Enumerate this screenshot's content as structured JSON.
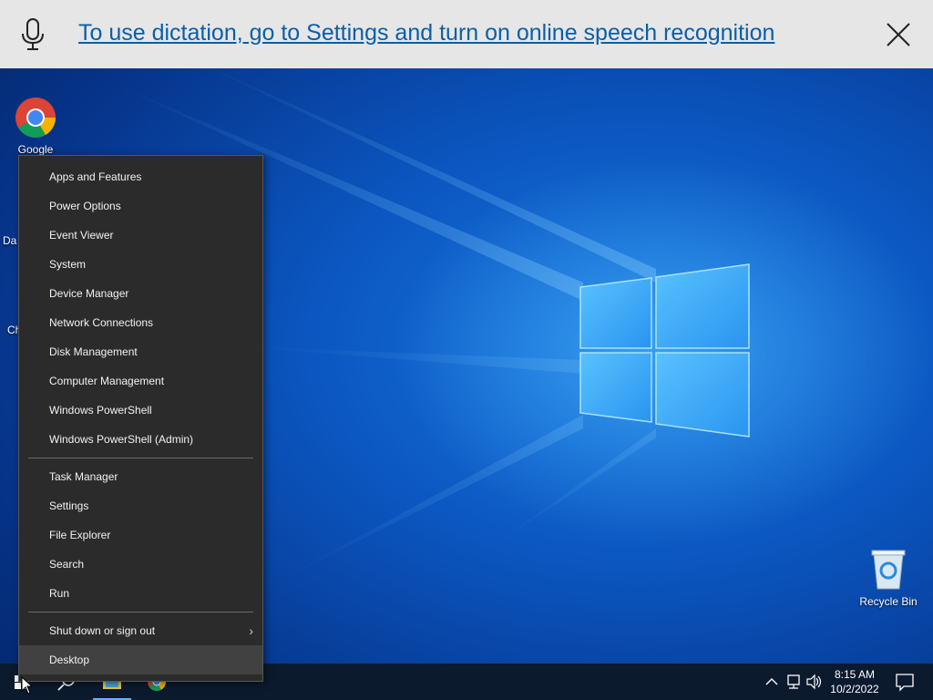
{
  "dictation": {
    "message": "To use dictation, go to Settings and turn on online speech recognition",
    "mic_icon": "microphone-icon",
    "close_icon": "close-icon"
  },
  "desktop_icons": [
    {
      "label": "Google",
      "icon": "chrome-icon"
    },
    {
      "label": "Recycle Bin",
      "icon": "recycle-bin-icon"
    }
  ],
  "partial_labels": [
    "Da",
    "Ch"
  ],
  "menu": {
    "group1": [
      "Apps and Features",
      "Power Options",
      "Event Viewer",
      "System",
      "Device Manager",
      "Network Connections",
      "Disk Management",
      "Computer Management",
      "Windows PowerShell",
      "Windows PowerShell (Admin)"
    ],
    "group2": [
      "Task Manager",
      "Settings",
      "File Explorer",
      "Search",
      "Run"
    ],
    "shutdown": "Shut down or sign out",
    "desktop": "Desktop"
  },
  "taskbar": {
    "time": "8:15 AM",
    "date": "10/2/2022",
    "pinned": [
      "windows-start-icon",
      "search-icon",
      "file-explorer-icon",
      "chrome-icon"
    ],
    "tray_icons": [
      "chevron-up-icon",
      "network-icon",
      "volume-icon",
      "notifications-icon"
    ]
  },
  "colors": {
    "menu_bg": "#2b2b2b",
    "menu_highlight": "#414141",
    "banner_bg": "#e6e6e6",
    "link": "#0a5ea8",
    "taskbar": "#0c1a2e"
  }
}
